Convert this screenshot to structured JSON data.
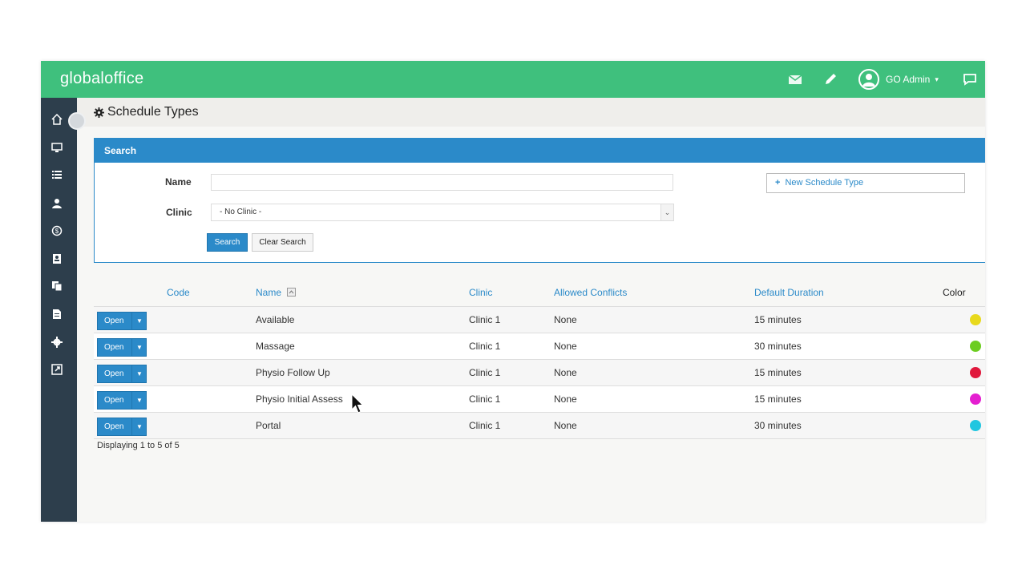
{
  "app": {
    "brand": "globaloffice"
  },
  "topbar": {
    "user_name": "GO Admin",
    "user_caret": "▾"
  },
  "page": {
    "title": "Schedule Types"
  },
  "search": {
    "header": "Search",
    "name_label": "Name",
    "name_value": "",
    "clinic_label": "Clinic",
    "clinic_selected": "- No Clinic -",
    "search_button": "Search",
    "clear_button": "Clear Search",
    "new_button": "New Schedule Type"
  },
  "grid": {
    "columns": [
      "Code",
      "Name",
      "Clinic",
      "Allowed Conflicts",
      "Default Duration",
      "Color"
    ],
    "open_label": "Open",
    "rows": [
      {
        "code": "",
        "name": "Available",
        "clinic": "Clinic 1",
        "conflicts": "None",
        "duration": "15 minutes",
        "color": "#e8d91c"
      },
      {
        "code": "",
        "name": "Massage",
        "clinic": "Clinic 1",
        "conflicts": "None",
        "duration": "30 minutes",
        "color": "#6ccd20"
      },
      {
        "code": "",
        "name": "Physio Follow Up",
        "clinic": "Clinic 1",
        "conflicts": "None",
        "duration": "15 minutes",
        "color": "#e0183c"
      },
      {
        "code": "",
        "name": "Physio Initial Assess",
        "clinic": "Clinic 1",
        "conflicts": "None",
        "duration": "15 minutes",
        "color": "#e41fd0"
      },
      {
        "code": "",
        "name": "Portal",
        "clinic": "Clinic 1",
        "conflicts": "None",
        "duration": "30 minutes",
        "color": "#21c6e0"
      }
    ],
    "footer": "Displaying 1 to 5 of 5"
  },
  "colors": {
    "topbar": "#3fc07d",
    "sidebar": "#2d3e4c",
    "accent": "#2b8ac9"
  },
  "icons": {
    "topbar": [
      "mail-icon",
      "pencil-icon",
      "user-avatar-icon",
      "chat-icon"
    ],
    "sidebar": [
      "home-icon",
      "monitor-icon",
      "list-icon",
      "user-icon",
      "dollar-icon",
      "address-book-icon",
      "copy-icon",
      "document-icon",
      "gear-icon",
      "external-link-icon"
    ]
  }
}
